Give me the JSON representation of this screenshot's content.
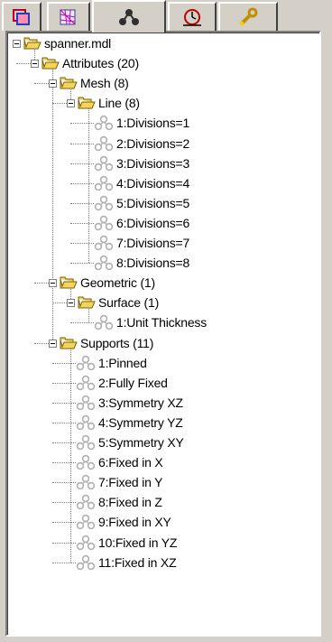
{
  "tabs": [
    {
      "name": "tab-layers",
      "icon": "layers-icon",
      "active": false
    },
    {
      "name": "tab-mesh",
      "icon": "mesh-icon",
      "active": false
    },
    {
      "name": "tab-attributes",
      "icon": "attributes-icon",
      "active": true
    },
    {
      "name": "tab-loadcase",
      "icon": "loadcase-icon",
      "active": false
    },
    {
      "name": "tab-utilities",
      "icon": "wrench-icon",
      "active": false
    }
  ],
  "tree": {
    "root": "spanner.mdl",
    "attributes": "Attributes (20)",
    "mesh": "Mesh (8)",
    "line": "Line (8)",
    "line_items": [
      "1:Divisions=1",
      "2:Divisions=2",
      "3:Divisions=3",
      "4:Divisions=4",
      "5:Divisions=5",
      "6:Divisions=6",
      "7:Divisions=7",
      "8:Divisions=8"
    ],
    "geometric": "Geometric (1)",
    "surface": "Surface (1)",
    "surface_items": [
      "1:Unit Thickness"
    ],
    "supports": "Supports (11)",
    "support_items": [
      "1:Pinned",
      "2:Fully Fixed",
      "3:Symmetry XZ",
      "4:Symmetry YZ",
      "5:Symmetry XY",
      "6:Fixed in X",
      "7:Fixed in Y",
      "8:Fixed in Z",
      "9:Fixed in XY",
      "10:Fixed in YZ",
      "11:Fixed in XZ"
    ]
  },
  "colors": {
    "folder": "#f4d35e",
    "folder_edge": "#7a6000",
    "attr_icon": "#b0b0b0"
  }
}
